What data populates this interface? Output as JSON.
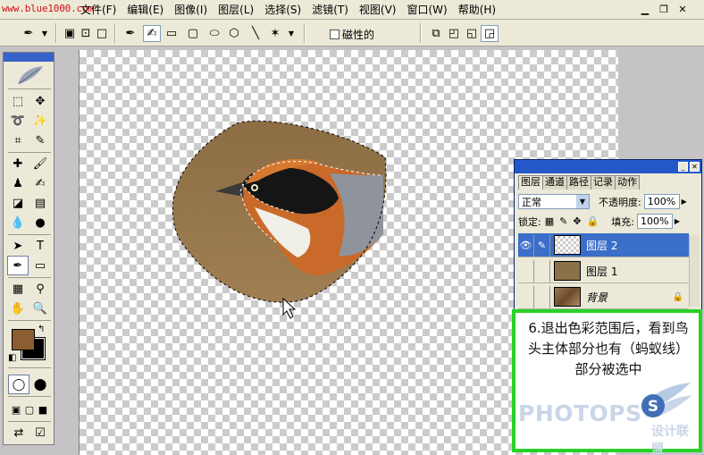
{
  "watermark": "www.blue1000.com",
  "menu": [
    "文件(F)",
    "编辑(E)",
    "图像(I)",
    "图层(L)",
    "选择(S)",
    "滤镜(T)",
    "视图(V)",
    "窗口(W)",
    "帮助(H)"
  ],
  "options": {
    "magnetic_label": "磁性的"
  },
  "colors": {
    "foreground": "#8b5e32",
    "background": "#000000",
    "caption_border": "#27d227"
  },
  "layers_panel": {
    "tabs": [
      "图层",
      "通道",
      "路径",
      "记录",
      "动作"
    ],
    "blend_mode": "正常",
    "opacity_label": "不透明度:",
    "opacity_value": "100%",
    "lock_label": "锁定:",
    "fill_label": "填充:",
    "fill_value": "100%",
    "layers": [
      {
        "name": "图层 2",
        "selected": true
      },
      {
        "name": "图层 1",
        "selected": false
      },
      {
        "name": "背景",
        "selected": false
      }
    ]
  },
  "caption": {
    "text": "6.退出色彩范围后，看到鸟头主体部分也有（蚂蚁线）部分被选中",
    "logo": "PHOTOPS",
    "logo_cn": "设计联盟"
  }
}
